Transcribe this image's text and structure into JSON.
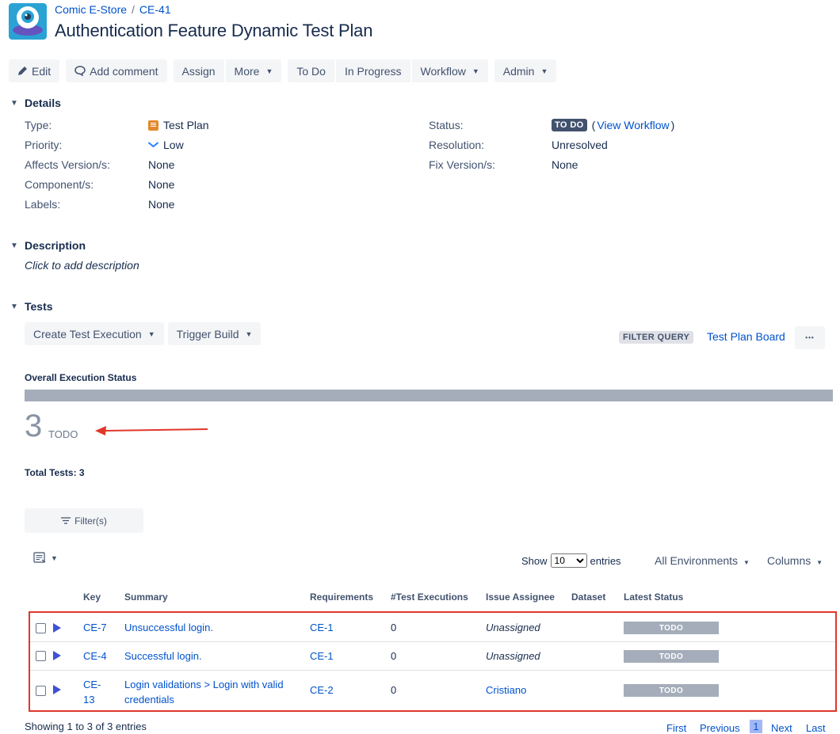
{
  "header": {
    "project": "Comic E-Store",
    "separator": "/",
    "issue_key": "CE-41",
    "title": "Authentication Feature Dynamic Test Plan"
  },
  "toolbar": {
    "edit": "Edit",
    "add_comment": "Add comment",
    "assign": "Assign",
    "more": "More",
    "to_do": "To Do",
    "in_progress": "In Progress",
    "workflow": "Workflow",
    "admin": "Admin"
  },
  "details": {
    "heading": "Details",
    "type_label": "Type:",
    "type_value": "Test Plan",
    "priority_label": "Priority:",
    "priority_value": "Low",
    "affects_label": "Affects Version/s:",
    "affects_value": "None",
    "component_label": "Component/s:",
    "component_value": "None",
    "labels_label": "Labels:",
    "labels_value": "None",
    "status_label": "Status:",
    "status_value": "TO DO",
    "view_workflow": "View Workflow",
    "paren_open": "(",
    "paren_close": ")",
    "resolution_label": "Resolution:",
    "resolution_value": "Unresolved",
    "fix_label": "Fix Version/s:",
    "fix_value": "None"
  },
  "description": {
    "heading": "Description",
    "placeholder": "Click to add description"
  },
  "tests": {
    "heading": "Tests",
    "create_execution": "Create Test Execution",
    "trigger_build": "Trigger Build",
    "filter_query": "FILTER QUERY",
    "test_plan_board": "Test Plan Board",
    "more_dots": "•••",
    "overall_label": "Overall Execution Status",
    "todo_fraction": 1.0,
    "count": "3",
    "count_label": "TODO",
    "total_tests": "Total Tests: 3",
    "filters_button": "Filter(s)",
    "show_label": "Show",
    "show_value": "10",
    "entries_label": "entries",
    "environments": "All Environments",
    "columns": "Columns",
    "headers": {
      "key": "Key",
      "summary": "Summary",
      "requirements": "Requirements",
      "executions": "#Test Executions",
      "assignee": "Issue Assignee",
      "dataset": "Dataset",
      "latest_status": "Latest Status"
    },
    "rows": [
      {
        "key": "CE-7",
        "summary": "Unsuccessful login.",
        "requirement": "CE-1",
        "executions": "0",
        "assignee": "Unassigned",
        "status": "TODO"
      },
      {
        "key": "CE-4",
        "summary": "Successful login.",
        "requirement": "CE-1",
        "executions": "0",
        "assignee": "Unassigned",
        "status": "TODO"
      },
      {
        "key_line1": "CE-",
        "key_line2": "13",
        "summary_line1": "Login validations > Login with valid",
        "summary_line2": "credentials",
        "requirement": "CE-2",
        "executions": "0",
        "assignee": "Cristiano",
        "status": "TODO"
      }
    ],
    "showing": "Showing 1 to 3 of 3 entries",
    "pager": {
      "first": "First",
      "previous": "Previous",
      "current": "1",
      "next": "Next",
      "last": "Last"
    }
  },
  "colors": {
    "link": "#0052cc",
    "todo_gray": "#a5adba",
    "annotation_red": "#e1372a"
  }
}
